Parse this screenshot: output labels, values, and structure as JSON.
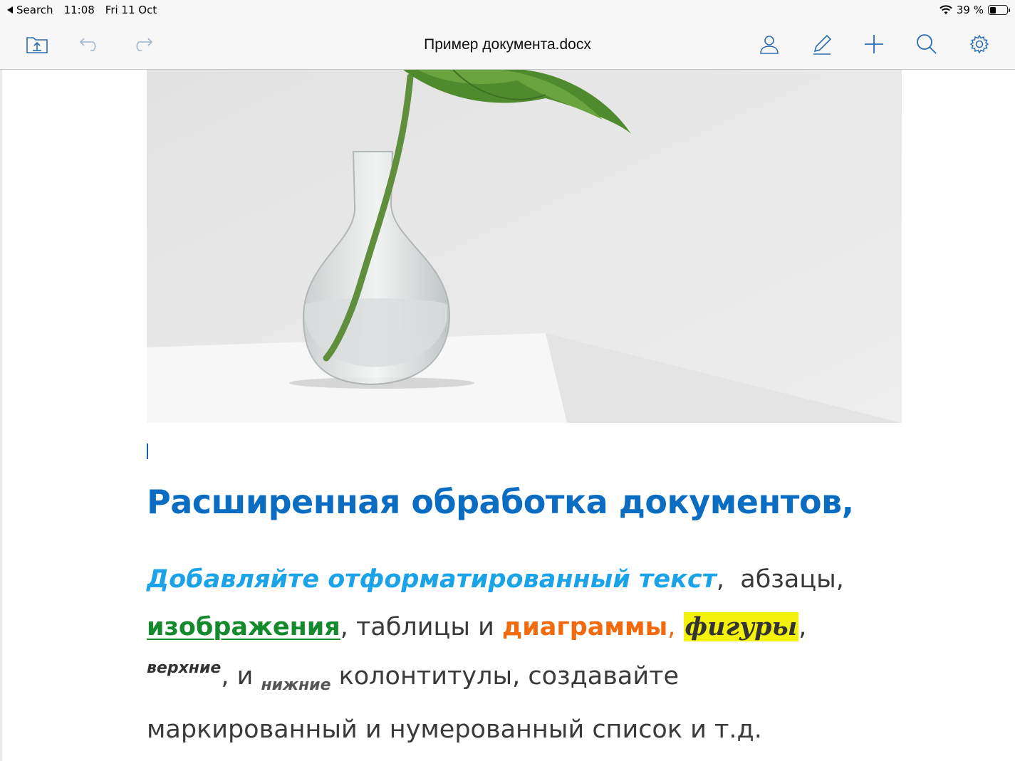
{
  "status_bar": {
    "back_label": "Search",
    "time": "11:08",
    "date": "Fri 11 Oct",
    "battery": "39 %",
    "battery_level": 0.39
  },
  "toolbar": {
    "title": "Пример документа.docx",
    "icons": [
      "folder-upload-icon",
      "undo-icon",
      "redo-icon",
      "user-icon",
      "pen-icon",
      "plus-icon",
      "search-icon",
      "gear-icon"
    ]
  },
  "document": {
    "heading": "Расширенная обработка документов,",
    "line1": {
      "formatted": "Добавляйте отформатированный текст",
      "sep": ",",
      "rest": "  абзацы,"
    },
    "line2": {
      "images": "изображения",
      "mid": ", таблицы и ",
      "charts": "диаграммы",
      "comma": ", ",
      "shapes": "фигуры",
      "end": ","
    },
    "line3": {
      "superscript": "верхние",
      "mid": ", и ",
      "subscript": "нижние",
      "rest": " колонтитулы, создавайте"
    },
    "line4": "маркированный и нумерованный список и т.д."
  },
  "colors": {
    "heading": "#0a6dc2",
    "italic_text": "#1aa3e8",
    "green": "#148a2c",
    "orange": "#f26a0c",
    "highlight": "#f4f20a"
  }
}
